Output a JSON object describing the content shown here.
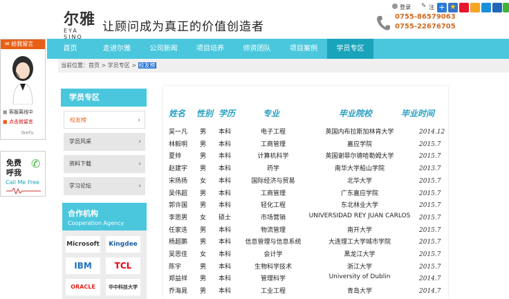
{
  "header": {
    "logo_cn": "尔雅",
    "logo_en": "EYA SINO",
    "slogan": "让顾问成为真正的价值创造者",
    "phone1": "0755-86579063",
    "phone2": "0755-22676705",
    "login": "登录",
    "register": "注",
    "social_icons": [
      "plus-icon",
      "star-icon",
      "weibo-icon",
      "tencent-weibo-icon",
      "qzone-icon",
      "renren-icon",
      "wechat-icon"
    ]
  },
  "nav": {
    "items": [
      "首页",
      "走进尔雅",
      "公司新闻",
      "项目培养",
      "师资团队",
      "项目案例",
      "学员专区"
    ],
    "active_index": 6
  },
  "chat": {
    "title": "给我留言",
    "service_label": "客服离线中",
    "click_label": "点击就留言",
    "footer": "tkefu"
  },
  "free_call": {
    "line1": "免费",
    "line2": "呼我",
    "en": "Call Me Free"
  },
  "breadcrumb": {
    "prefix": "当前位置：",
    "home": "首页",
    "sep1": " > ",
    "section": "学员专区",
    "sep2": " > ",
    "current": "校友榜"
  },
  "sidebar": {
    "title": "学员专区",
    "items": [
      {
        "label": "校友榜",
        "active": true
      },
      {
        "label": "学员风采"
      },
      {
        "label": "资料下载"
      },
      {
        "label": "学习论坛"
      }
    ],
    "arrow": "›",
    "coop_cn": "合作机构",
    "coop_en": "Cooperation Agency",
    "partners": [
      "Microsoft",
      "Kingdee",
      "IBM",
      "TCL",
      "ORACLE",
      "华中科技大学"
    ]
  },
  "table": {
    "headers": [
      "姓名",
      "性别",
      "学历",
      "专业",
      "毕业院校",
      "毕业时间"
    ],
    "rows": [
      [
        "吴一凡",
        "男",
        "本科",
        "电子工程",
        "英国内布拉斯加林肯大学",
        "2014.12"
      ],
      [
        "林毅明",
        "男",
        "本科",
        "工商管理",
        "嘉应学院",
        "2015.7"
      ],
      [
        "夏帅",
        "男",
        "本科",
        "计算机科学",
        "英国谢菲尔德哈勒姆大学",
        "2015.7"
      ],
      [
        "赵建宇",
        "男",
        "本科",
        "药学",
        "南华大学船山学院",
        "2013.7"
      ],
      [
        "宋扬扬",
        "女",
        "本科",
        "国际经济与贸易",
        "北华大学",
        "2015.7"
      ],
      [
        "吴伟超",
        "男",
        "本科",
        "工商管理",
        "广东嘉应学院",
        "2015.7"
      ],
      [
        "郭许国",
        "男",
        "本科",
        "轻化工程",
        "东北林业大学",
        "2015.7"
      ],
      [
        "李思男",
        "女",
        "硕士",
        "市场营销",
        "UNIVERSIDAD REY JUAN CARLOS",
        "2015.7"
      ],
      [
        "任家迭",
        "男",
        "本科",
        "物流管理",
        "南开大学",
        "2015.7"
      ],
      [
        "杨超鹏",
        "男",
        "本科",
        "信息管理与信息系统",
        "大连理工大学城市学院",
        "2015.7"
      ],
      [
        "吴思佳",
        "女",
        "本科",
        "会计学",
        "黑龙江大学",
        "2015.7"
      ],
      [
        "陈宇",
        "男",
        "本科",
        "生物科学技术",
        "浙江大学",
        "2015.7"
      ],
      [
        "郑益祥",
        "男",
        "本科",
        "管理科学",
        "University of Dublin",
        "2014.7"
      ],
      [
        "乔海晁",
        "男",
        "本科",
        "工业工程",
        "青岛大学",
        "2014.7"
      ]
    ]
  }
}
